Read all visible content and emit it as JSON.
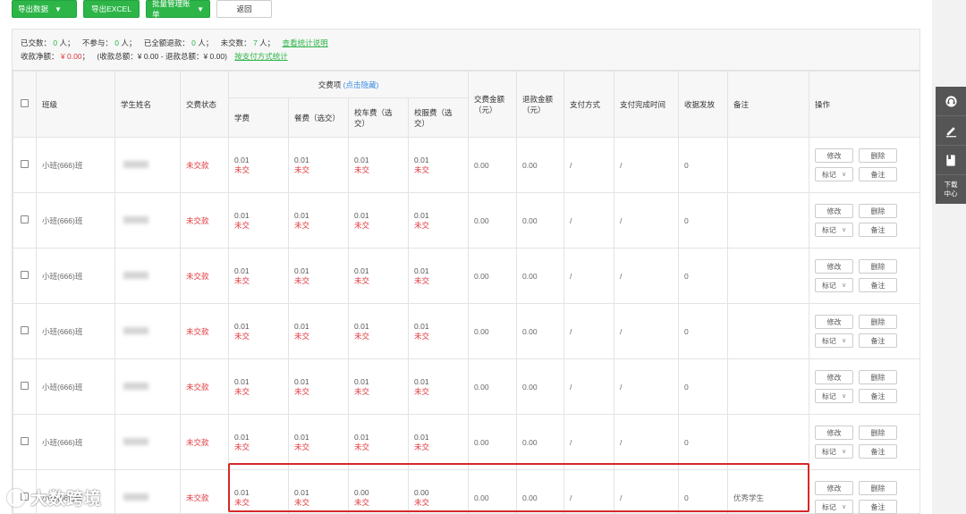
{
  "toolbar": {
    "export_data": "导出数据",
    "export_excel": "导出EXCEL",
    "batch_bills": "批量管理账单",
    "back": "返回"
  },
  "stats": {
    "paid_label": "已交数：",
    "paid_count": "0",
    "nonpart_label": "不参与：",
    "nonpart_count": "0",
    "fullrefund_label": "已全额退款：",
    "fullrefund_count": "0",
    "unpaid_label": "未交数：",
    "unpaid_count": "7",
    "unit": "人；",
    "unit_last": "人；",
    "explain_link": "查看统计说明",
    "net_label": "收款净额：",
    "net_value": "¥ 0.00",
    "net_sep": "；",
    "detail_text": "(收款总额：¥ 0.00   -   退款总额：¥ 0.00)",
    "by_method_link": "按支付方式统计"
  },
  "table": {
    "headers": {
      "class": "班级",
      "student": "学生姓名",
      "status": "交费状态",
      "group": "交费项",
      "group_toggle": "(点击隐藏)",
      "tuition": "学费",
      "meal": "餐费（选交）",
      "bus": "校车费（选交）",
      "uniform": "校服费（选交）",
      "pay_total": "交费金额（元）",
      "refund_total": "退款金额（元）",
      "method": "支付方式",
      "done_time": "支付完成时间",
      "receipt": "收据发放",
      "remark": "备注",
      "ops": "操作"
    },
    "rows": [
      {
        "class": "小班(666)班",
        "status": "未交款",
        "tuition": "0.01",
        "tuition_s": "未交",
        "meal": "0.01",
        "meal_s": "未交",
        "bus": "0.01",
        "bus_s": "未交",
        "uniform": "0.01",
        "uniform_s": "未交",
        "pay": "0.00",
        "refund": "0.00",
        "method": "/",
        "time": "/",
        "receipt": "0",
        "remark": ""
      },
      {
        "class": "小班(666)班",
        "status": "未交款",
        "tuition": "0.01",
        "tuition_s": "未交",
        "meal": "0.01",
        "meal_s": "未交",
        "bus": "0.01",
        "bus_s": "未交",
        "uniform": "0.01",
        "uniform_s": "未交",
        "pay": "0.00",
        "refund": "0.00",
        "method": "/",
        "time": "/",
        "receipt": "0",
        "remark": ""
      },
      {
        "class": "小班(666)班",
        "status": "未交款",
        "tuition": "0.01",
        "tuition_s": "未交",
        "meal": "0.01",
        "meal_s": "未交",
        "bus": "0.01",
        "bus_s": "未交",
        "uniform": "0.01",
        "uniform_s": "未交",
        "pay": "0.00",
        "refund": "0.00",
        "method": "/",
        "time": "/",
        "receipt": "0",
        "remark": ""
      },
      {
        "class": "小班(666)班",
        "status": "未交款",
        "tuition": "0.01",
        "tuition_s": "未交",
        "meal": "0.01",
        "meal_s": "未交",
        "bus": "0.01",
        "bus_s": "未交",
        "uniform": "0.01",
        "uniform_s": "未交",
        "pay": "0.00",
        "refund": "0.00",
        "method": "/",
        "time": "/",
        "receipt": "0",
        "remark": ""
      },
      {
        "class": "小班(666)班",
        "status": "未交款",
        "tuition": "0.01",
        "tuition_s": "未交",
        "meal": "0.01",
        "meal_s": "未交",
        "bus": "0.01",
        "bus_s": "未交",
        "uniform": "0.01",
        "uniform_s": "未交",
        "pay": "0.00",
        "refund": "0.00",
        "method": "/",
        "time": "/",
        "receipt": "0",
        "remark": ""
      },
      {
        "class": "小班(666)班",
        "status": "未交款",
        "tuition": "0.01",
        "tuition_s": "未交",
        "meal": "0.01",
        "meal_s": "未交",
        "bus": "0.01",
        "bus_s": "未交",
        "uniform": "0.01",
        "uniform_s": "未交",
        "pay": "0.00",
        "refund": "0.00",
        "method": "/",
        "time": "/",
        "receipt": "0",
        "remark": ""
      },
      {
        "class": "小班(666)班",
        "status": "未交款",
        "tuition": "0.01",
        "tuition_s": "未交",
        "meal": "0.01",
        "meal_s": "未交",
        "bus": "0.00",
        "bus_s": "未交",
        "uniform": "0.00",
        "uniform_s": "未交",
        "pay": "0.00",
        "refund": "0.00",
        "method": "/",
        "time": "/",
        "receipt": "0",
        "remark": "优秀学生"
      }
    ],
    "row_ops": {
      "edit": "修改",
      "delete": "删除",
      "mark": "标记",
      "note": "备注"
    }
  },
  "sidebar": {
    "items": [
      {
        "icon": "headset-icon"
      },
      {
        "icon": "edit-icon"
      },
      {
        "icon": "book-icon"
      }
    ],
    "download_line1": "下载",
    "download_line2": "中心"
  },
  "watermark": {
    "text": "大数跨境"
  },
  "colors": {
    "primary_green": "#2db548",
    "alert_red": "#e0393e",
    "link_blue": "#3a8ee6",
    "highlight_red": "#d62828",
    "sidebar_gray": "#555555"
  }
}
